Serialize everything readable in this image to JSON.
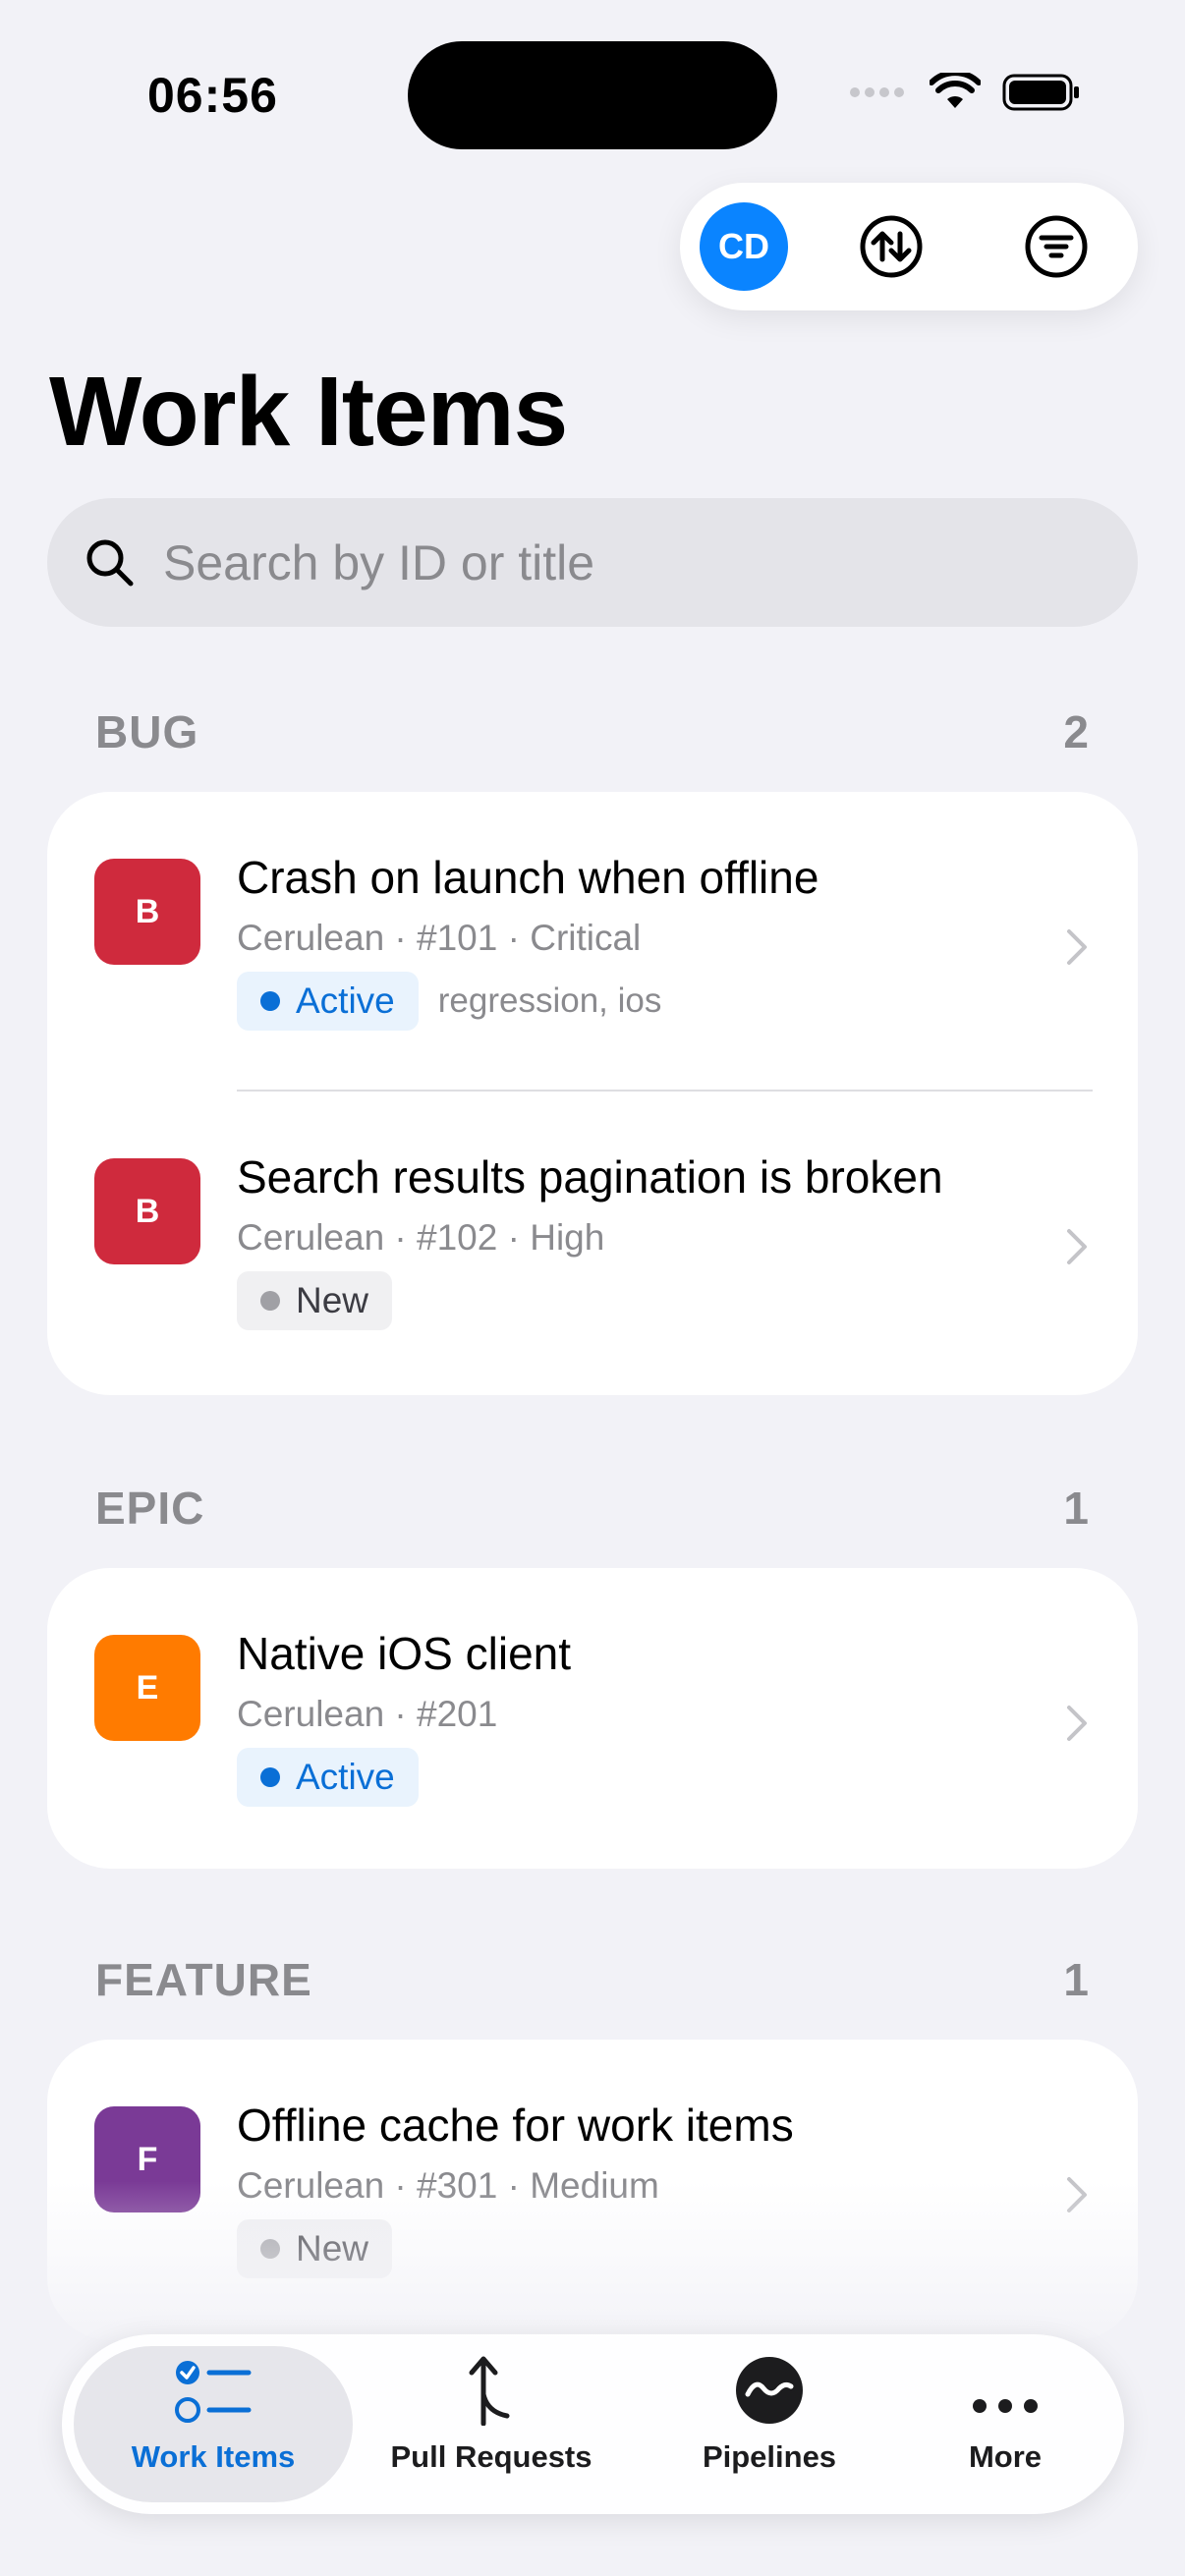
{
  "status_bar": {
    "time": "06:56"
  },
  "toolbar": {
    "avatar_initials": "CD",
    "sort_icon": "arrow-up-down-circle-icon",
    "filter_icon": "filter-circle-icon"
  },
  "page": {
    "title": "Work Items"
  },
  "search": {
    "placeholder": "Search by ID or title",
    "value": ""
  },
  "sections": [
    {
      "name": "BUG",
      "count": "2",
      "items": [
        {
          "icon_letter": "B",
          "icon_color": "#cf2a3d",
          "title": "Crash on launch when offline",
          "meta": "Cerulean · #101 · Critical",
          "state": "Active",
          "labels": "regression, ios"
        },
        {
          "icon_letter": "B",
          "icon_color": "#cf2a3d",
          "title": "Search results pagination is broken",
          "meta": "Cerulean · #102 · High",
          "state": "New",
          "labels": ""
        }
      ]
    },
    {
      "name": "EPIC",
      "count": "1",
      "items": [
        {
          "icon_letter": "E",
          "icon_color": "#ff7b00",
          "title": "Native iOS client",
          "meta": "Cerulean · #201",
          "state": "Active",
          "labels": ""
        }
      ]
    },
    {
      "name": "FEATURE",
      "count": "1",
      "items": [
        {
          "icon_letter": "F",
          "icon_color": "#7a3a96",
          "title": "Offline cache for work items",
          "meta": "Cerulean · #301 · Medium",
          "state": "New",
          "labels": ""
        }
      ]
    }
  ],
  "tabbar": {
    "tabs": [
      {
        "label": "Work Items",
        "icon": "checklist-icon",
        "selected": true
      },
      {
        "label": "Pull Requests",
        "icon": "merge-arrow-icon",
        "selected": false
      },
      {
        "label": "Pipelines",
        "icon": "pipeline-wave-icon",
        "selected": false
      },
      {
        "label": "More",
        "icon": "ellipsis-icon",
        "selected": false
      }
    ]
  },
  "colors": {
    "accent": "#0a84ff",
    "active_state": "#0a6fd6",
    "background": "#f2f2f7"
  }
}
